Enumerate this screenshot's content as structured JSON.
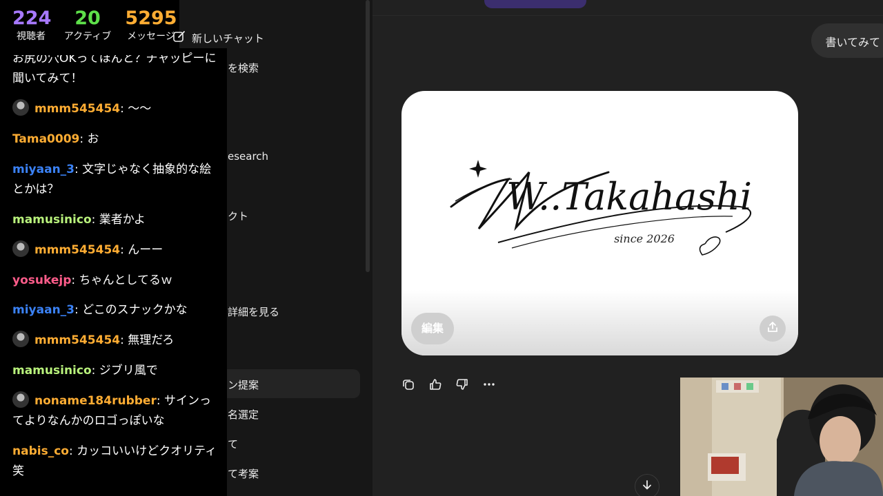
{
  "stats": [
    {
      "value": "224",
      "label": "視聴者",
      "color": "#a779ff"
    },
    {
      "value": "20",
      "label": "アクティブ",
      "color": "#5ee04a"
    },
    {
      "value": "5295",
      "label": "メッセージ",
      "color": "#ffad33"
    }
  ],
  "sidebar": {
    "new_chat": "新しいチャット",
    "items": [
      {
        "label": "を検索"
      },
      {
        "label": "esearch"
      },
      {
        "label": "クト"
      },
      {
        "label": "詳細を見る"
      },
      {
        "label": "ン提案"
      },
      {
        "label": "名選定"
      },
      {
        "label": "て"
      },
      {
        "label": "て考案"
      }
    ]
  },
  "main": {
    "user_message": "書いてみて",
    "image": {
      "logo_text": "W..Takahashi",
      "logo_sub": "since 2026",
      "edit_label": "編集"
    },
    "icons": [
      "copy-icon",
      "thumbs-up-icon",
      "thumbs-down-icon",
      "more-icon",
      "share-icon",
      "arrow-down-icon",
      "edit-square-icon"
    ]
  },
  "chat": {
    "messages": [
      {
        "user": "",
        "text": "お尻の穴OKってほんと？チャッピーに聞いてみて！",
        "color": "#ffffff",
        "avatar": false
      },
      {
        "user": "mmm545454",
        "text": "〜〜",
        "color": "#ffad33",
        "avatar": true
      },
      {
        "user": "Tama0009",
        "text": "お",
        "color": "#ffad33",
        "avatar": false
      },
      {
        "user": "miyaan_3",
        "text": "文字じゃなく抽象的な絵とかは？",
        "color": "#3b82f6",
        "avatar": false
      },
      {
        "user": "mamusinico",
        "text": "業者かよ",
        "color": "#b9f27c",
        "avatar": false
      },
      {
        "user": "mmm545454",
        "text": "んーー",
        "color": "#ffad33",
        "avatar": true
      },
      {
        "user": "yosukejp",
        "text": "ちゃんとしてるｗ",
        "color": "#ff5c8a",
        "avatar": false
      },
      {
        "user": "miyaan_3",
        "text": "どこのスナックかな",
        "color": "#3b82f6",
        "avatar": false
      },
      {
        "user": "mmm545454",
        "text": "無理だろ",
        "color": "#ffad33",
        "avatar": true
      },
      {
        "user": "mamusinico",
        "text": "ジブリ風で",
        "color": "#b9f27c",
        "avatar": false
      },
      {
        "user": "noname184rubber",
        "text": "サインってよりなんかのロゴっぽいな",
        "color": "#ffad33",
        "avatar": true
      },
      {
        "user": "nabis_co",
        "text": "カッコいいけどクオリティ笑",
        "color": "#ffad33",
        "avatar": false
      }
    ]
  }
}
